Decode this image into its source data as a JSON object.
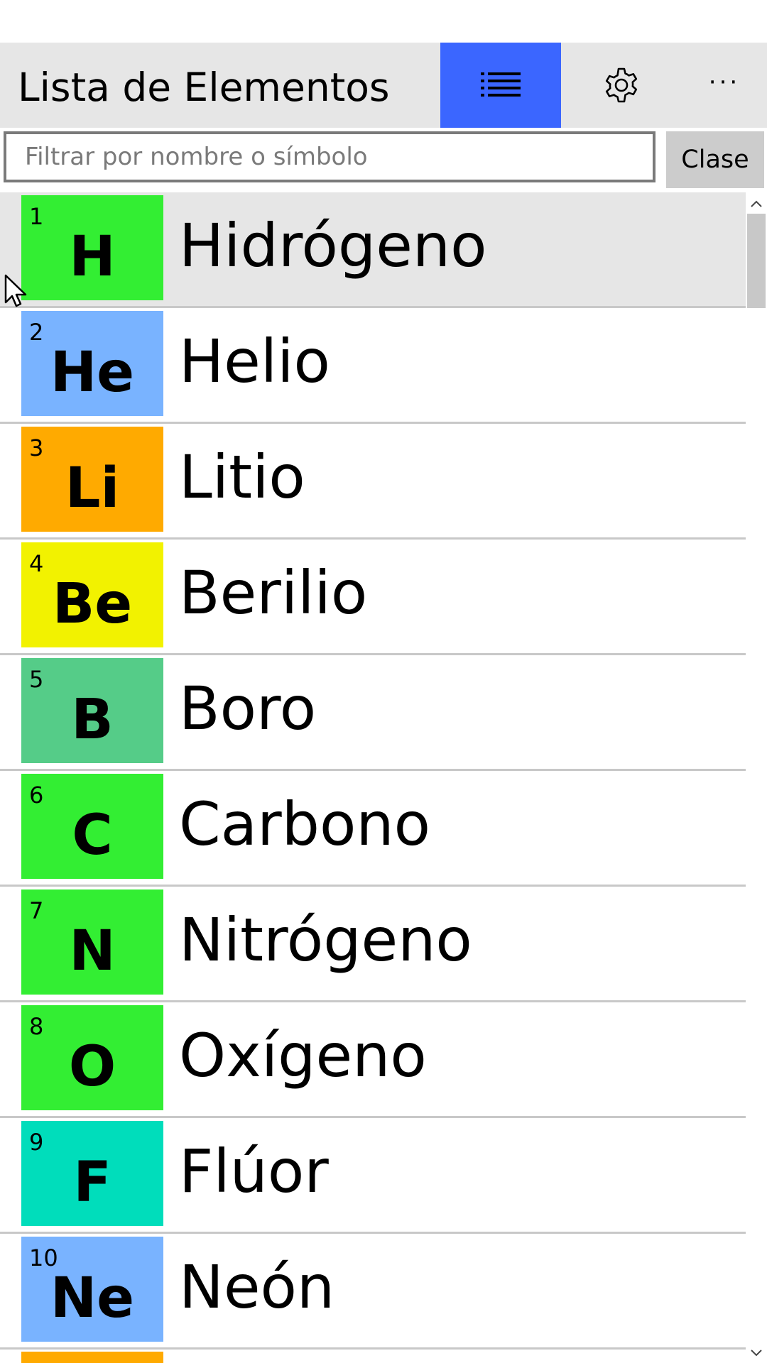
{
  "app": {
    "title": "Lista de Elementos"
  },
  "toolbar": {
    "list_icon": "list-icon",
    "settings_icon": "gear-icon",
    "more_label": "···",
    "accent_color": "#3b66ff"
  },
  "filter": {
    "placeholder": "Filtrar por nombre o símbolo",
    "value": "",
    "clear_label": "Clase"
  },
  "elements": [
    {
      "number": "1",
      "symbol": "H",
      "name": "Hidrógeno",
      "color": "#33ee33"
    },
    {
      "number": "2",
      "symbol": "He",
      "name": "Helio",
      "color": "#79b3ff"
    },
    {
      "number": "3",
      "symbol": "Li",
      "name": "Litio",
      "color": "#ffaa00"
    },
    {
      "number": "4",
      "symbol": "Be",
      "name": "Berilio",
      "color": "#f2f200"
    },
    {
      "number": "5",
      "symbol": "B",
      "name": "Boro",
      "color": "#55cc88"
    },
    {
      "number": "6",
      "symbol": "C",
      "name": "Carbono",
      "color": "#33ee33"
    },
    {
      "number": "7",
      "symbol": "N",
      "name": "Nitrógeno",
      "color": "#33ee33"
    },
    {
      "number": "8",
      "symbol": "O",
      "name": "Oxígeno",
      "color": "#33ee33"
    },
    {
      "number": "9",
      "symbol": "F",
      "name": "Flúor",
      "color": "#00ddbb"
    },
    {
      "number": "10",
      "symbol": "Ne",
      "name": "Neón",
      "color": "#79b3ff"
    }
  ],
  "next_tile_color": "#ffaa00",
  "selected_index": 0
}
